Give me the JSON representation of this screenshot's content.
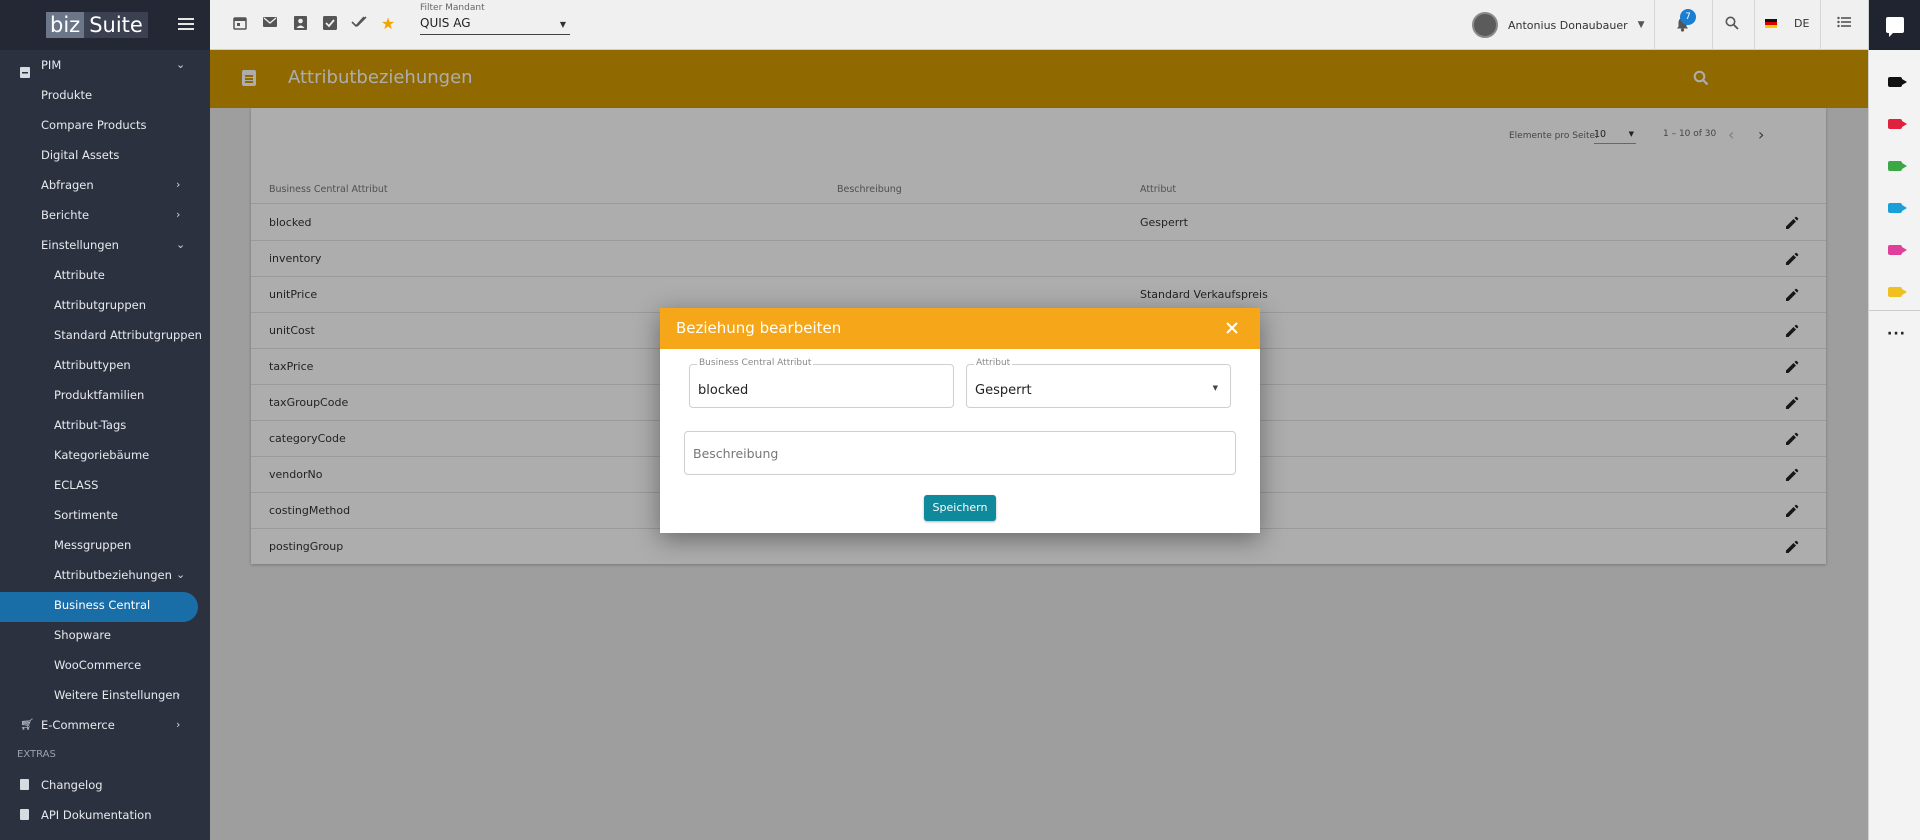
{
  "app": {
    "logo_part1": "biz",
    "logo_part2": "Suite"
  },
  "sidebar": {
    "items": [
      {
        "label": "PIM",
        "icon": "storage-icon",
        "level": 1,
        "chevron": "down"
      },
      {
        "label": "Produkte",
        "level": 1
      },
      {
        "label": "Compare Products",
        "level": 1
      },
      {
        "label": "Digital Assets",
        "level": 1
      },
      {
        "label": "Abfragen",
        "level": 1,
        "chevron": "right"
      },
      {
        "label": "Berichte",
        "level": 1,
        "chevron": "right"
      },
      {
        "label": "Einstellungen",
        "level": 1,
        "chevron": "down"
      },
      {
        "label": "Attribute",
        "level": 2
      },
      {
        "label": "Attributgruppen",
        "level": 2
      },
      {
        "label": "Standard Attributgruppen",
        "level": 2
      },
      {
        "label": "Attributtypen",
        "level": 2
      },
      {
        "label": "Produktfamilien",
        "level": 2
      },
      {
        "label": "Attribut-Tags",
        "level": 2
      },
      {
        "label": "Kategoriebäume",
        "level": 2
      },
      {
        "label": "ECLASS",
        "level": 2
      },
      {
        "label": "Sortimente",
        "level": 2
      },
      {
        "label": "Messgruppen",
        "level": 2
      },
      {
        "label": "Attributbeziehungen",
        "level": 2,
        "chevron": "down"
      },
      {
        "label": "Business Central",
        "level": 2,
        "active": true
      },
      {
        "label": "Shopware",
        "level": 2
      },
      {
        "label": "WooCommerce",
        "level": 2
      },
      {
        "label": "Weitere Einstellungen",
        "level": 2,
        "chevron": "right"
      },
      {
        "label": "E-Commerce",
        "icon": "cart-icon",
        "level": 1,
        "chevron": "right"
      }
    ],
    "section_extras": "EXTRAS",
    "extras": [
      {
        "label": "Changelog",
        "icon": "document-icon"
      },
      {
        "label": "API Dokumentation",
        "icon": "api-doc-icon"
      }
    ]
  },
  "topbar": {
    "filter_label": "Filter Mandant",
    "filter_value": "QUIS AG",
    "user_name": "Antonius Donaubauer",
    "notification_count": "7",
    "language": "DE"
  },
  "header": {
    "title": "Attributbeziehungen"
  },
  "table": {
    "paginator": {
      "label": "Elemente pro Seite:",
      "page_size": "10",
      "range": "1 – 10 of 30"
    },
    "columns": [
      "Business Central Attribut",
      "Beschreibung",
      "Attribut"
    ],
    "rows": [
      {
        "bc_attr": "blocked",
        "desc": "",
        "attr": "Gesperrt"
      },
      {
        "bc_attr": "inventory",
        "desc": "",
        "attr": ""
      },
      {
        "bc_attr": "unitPrice",
        "desc": "",
        "attr": "Standard Verkaufspreis"
      },
      {
        "bc_attr": "unitCost",
        "desc": "",
        "attr": ""
      },
      {
        "bc_attr": "taxPrice",
        "desc": "",
        "attr": ""
      },
      {
        "bc_attr": "taxGroupCode",
        "desc": "",
        "attr": ""
      },
      {
        "bc_attr": "categoryCode",
        "desc": "",
        "attr": ""
      },
      {
        "bc_attr": "vendorNo",
        "desc": "",
        "attr": ""
      },
      {
        "bc_attr": "costingMethod",
        "desc": "",
        "attr": ""
      },
      {
        "bc_attr": "postingGroup",
        "desc": "",
        "attr": ""
      }
    ]
  },
  "dialog": {
    "title": "Beziehung bearbeiten",
    "bc_attr_label": "Business Central Attribut",
    "bc_attr_value": "blocked",
    "attr_label": "Attribut",
    "attr_value": "Gesperrt",
    "desc_placeholder": "Beschreibung",
    "save_label": "Speichern"
  },
  "colors": {
    "header_bg": "#d59c00",
    "dialog_header_bg": "#f5a719",
    "save_button_bg": "#0f8a9c",
    "sidebar_bg": "#2c3140",
    "active_pill": "#1a6ea8",
    "badge": "#1a7ed1"
  }
}
